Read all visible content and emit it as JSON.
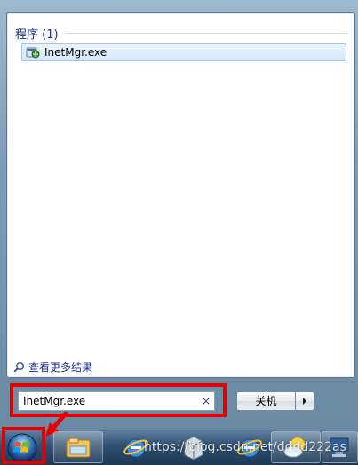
{
  "start_menu": {
    "section_title": "程序 (1)",
    "results": [
      {
        "label": "InetMgr.exe",
        "icon": "iis-manager-icon"
      }
    ],
    "see_more_label": "查看更多结果",
    "search": {
      "value": "InetMgr.exe",
      "clear_glyph": "×"
    },
    "shutdown_label": "关机"
  },
  "taskbar": {
    "items": [
      {
        "name": "windows-explorer",
        "icon": "folder-icon"
      },
      {
        "name": "internet-explorer",
        "icon": "ie-icon"
      },
      {
        "name": "network-app",
        "icon": "server-icon"
      },
      {
        "name": "internet-explorer-2",
        "icon": "ie-icon"
      },
      {
        "name": "weather-app",
        "icon": "weather-icon"
      },
      {
        "name": "computer",
        "icon": "computer-icon"
      }
    ],
    "watermark": "https://blog.csdn.net/dddd222as"
  },
  "colors": {
    "highlight": "#e30000",
    "section_title": "#1e3287",
    "selection": "#d6e9fb"
  }
}
